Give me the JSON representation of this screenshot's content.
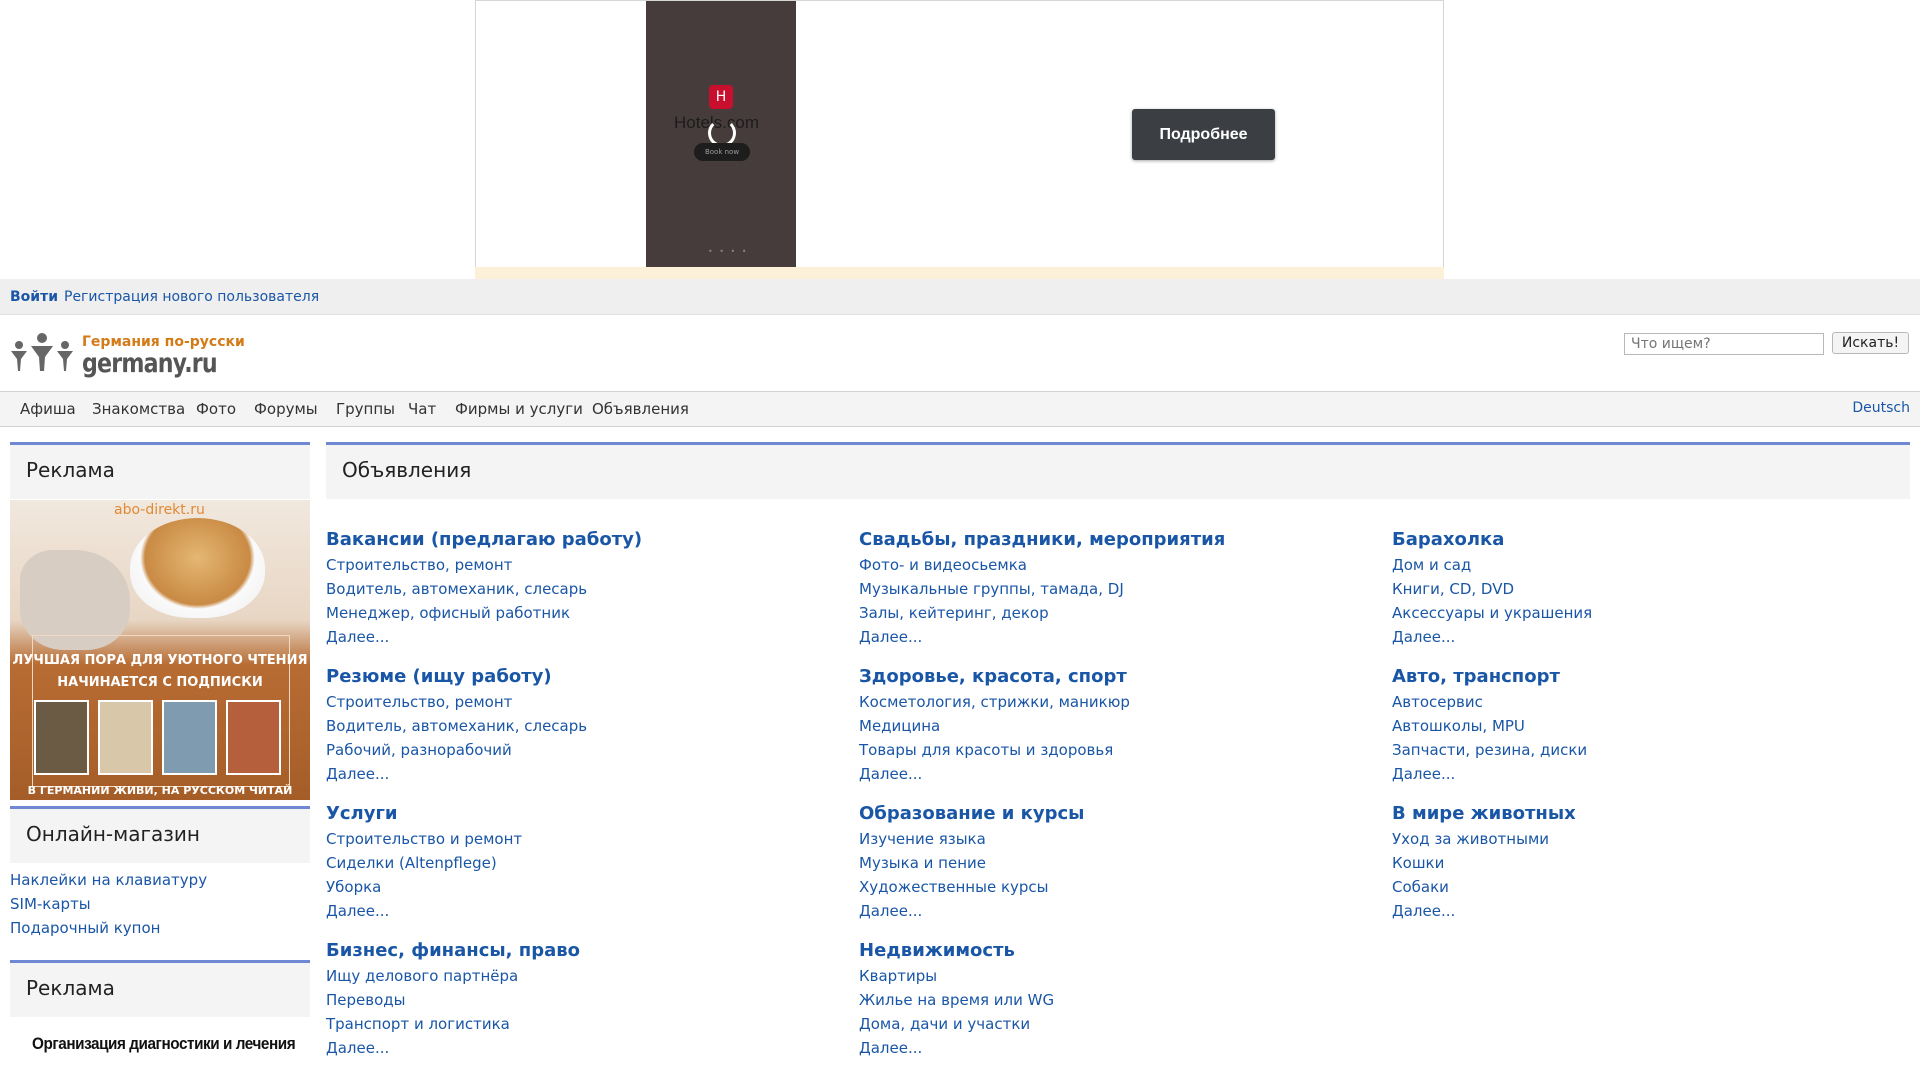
{
  "top_ad": {
    "brand": "Hotels.com",
    "book_now": "Book now",
    "more_button": "Подробнее"
  },
  "auth": {
    "login": "Войти",
    "register": "Регистрация нового пользователя"
  },
  "header": {
    "tagline": "Германия по-русски",
    "site_name": "germany.ru",
    "search_placeholder": "Что ищем?",
    "search_button": "Искать!"
  },
  "nav": {
    "items": [
      "Афиша",
      "Знакомства",
      "Фото",
      "Форумы",
      "Группы",
      "Чат",
      "Фирмы и услуги",
      "Объявления"
    ],
    "language": "Deutsch"
  },
  "sidebar": {
    "ad_title": "Реклама",
    "ad_banner": {
      "site": "abo-direkt.ru",
      "line1": "ЛУЧШАЯ ПОРА ДЛЯ УЮТНОГО ЧТЕНИЯ",
      "line2": "НАЧИНАЕТСЯ С ПОДПИСКИ",
      "bottom": "В ГЕРМАНИИ ЖИВИ, НА РУССКОМ ЧИТАЙ"
    },
    "shop_title": "Онлайн-магазин",
    "shop_links": [
      "Наклейки на клавиатуру",
      "SIM-карты",
      "Подарочный купон"
    ],
    "ad2_title": "Реклама",
    "ad2_text": "Организация диагностики и лечения"
  },
  "main": {
    "title": "Объявления",
    "columns": [
      [
        {
          "title": "Вакансии (предлагаю работу)",
          "links": [
            "Строительство, ремонт",
            "Водитель, автомеханик, слесарь",
            "Менеджер, офисный работник",
            "Далее..."
          ]
        },
        {
          "title": "Резюме (ищу работу)",
          "links": [
            "Строительство, ремонт",
            "Водитель, автомеханик, слесарь",
            "Рабочий, разнорабочий",
            "Далее..."
          ]
        },
        {
          "title": "Услуги",
          "links": [
            "Строительство и ремонт",
            "Сиделки (Altenpflege)",
            "Уборка",
            "Далее..."
          ]
        },
        {
          "title": "Бизнес, финансы, право",
          "links": [
            "Ищу делового партнёра",
            "Переводы",
            "Транспорт и логистика",
            "Далее..."
          ]
        }
      ],
      [
        {
          "title": "Свадьбы, праздники, мероприятия",
          "links": [
            "Фото- и видеосьемка",
            "Музыкальные группы, тамада, DJ",
            "Залы, кейтеринг, декор",
            "Далее..."
          ]
        },
        {
          "title": "Здоровье, красота, спорт",
          "links": [
            "Косметология, стрижки, маникюр",
            "Медицина",
            "Товары для красоты и здоровья",
            "Далее..."
          ]
        },
        {
          "title": "Образование и курсы",
          "links": [
            "Изучение языка",
            "Музыка и пение",
            "Художественные курсы",
            "Далее..."
          ]
        },
        {
          "title": "Недвижимость",
          "links": [
            "Квартиры",
            "Жилье на время или WG",
            "Дома, дачи и участки",
            "Далее..."
          ]
        }
      ],
      [
        {
          "title": "Барахолка",
          "links": [
            "Дом и сад",
            "Книги, CD, DVD",
            "Аксессуары и украшения",
            "Далее..."
          ]
        },
        {
          "title": "Авто, транспорт",
          "links": [
            "Автосервис",
            "Автошколы, MPU",
            "Запчасти, резина, диски",
            "Далее..."
          ]
        },
        {
          "title": "В мире животных",
          "links": [
            "Уход за животными",
            "Кошки",
            "Собаки",
            "Далее..."
          ]
        }
      ]
    ]
  }
}
